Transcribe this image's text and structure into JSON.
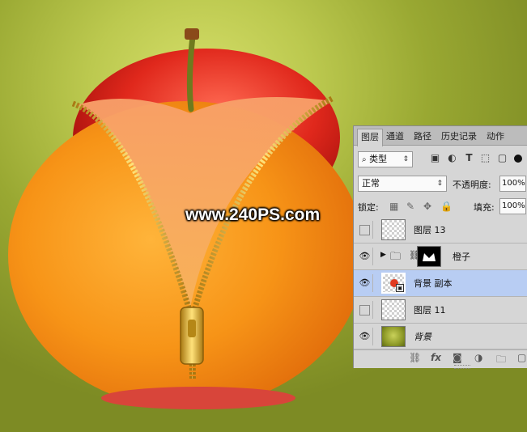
{
  "watermark": "www.240PS.com",
  "panel": {
    "tabs": [
      "图层",
      "通道",
      "路径",
      "历史记录",
      "动作"
    ],
    "active_tab": "图层",
    "filter": {
      "search_icon": "search-icon",
      "value": "类型"
    },
    "filter_icons": [
      "image-filter-icon",
      "adjustment-filter-icon",
      "type-filter-icon",
      "shape-filter-icon",
      "smart-object-filter-icon"
    ],
    "blend_mode": "正常",
    "opacity_label": "不透明度:",
    "opacity_value": "100%",
    "lock_label": "锁定:",
    "fill_label": "填充:",
    "fill_value": "100%",
    "layers": [
      {
        "name": "图层 13",
        "visible": false,
        "selected": false
      },
      {
        "name": "橙子",
        "visible": true,
        "selected": false,
        "type": "group",
        "has_mask": true
      },
      {
        "name": "背景 副本",
        "visible": true,
        "selected": true,
        "type": "smart-object"
      },
      {
        "name": "图层 11",
        "visible": false,
        "selected": false
      },
      {
        "name": "背景",
        "visible": true,
        "selected": false,
        "italic": true
      }
    ],
    "footer_icons": [
      "link-icon",
      "fx-icon",
      "mask-icon",
      "adjustment-icon",
      "folder-icon",
      "new-layer-icon"
    ],
    "footer_fx": "fx"
  }
}
